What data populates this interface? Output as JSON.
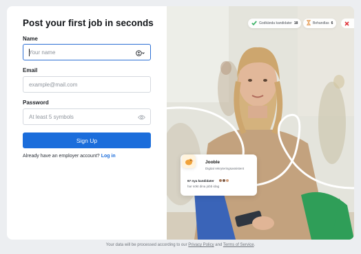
{
  "form": {
    "title": "Post your first job in seconds",
    "name": {
      "label": "Name",
      "placeholder": "Your name",
      "icon": "user-check-icon"
    },
    "email": {
      "label": "Email",
      "placeholder": "example@mail.com"
    },
    "password": {
      "label": "Password",
      "placeholder": "At least 5 symbols",
      "icon": "eye-icon"
    },
    "submit_label": "Sign Up",
    "login_prompt": "Already have an employer account?",
    "login_link": "Log in"
  },
  "hero": {
    "stats": [
      {
        "label": "Godkända kandidater",
        "value": "18",
        "icon": "check-icon",
        "color": "#3fb36a"
      },
      {
        "label": "Behandlas",
        "value": "6",
        "icon": "hourglass-icon",
        "color": "#e2964b"
      }
    ],
    "reject_icon": "close-icon",
    "reject_color": "#e0383e",
    "card": {
      "name": "Jooble",
      "role": "Digital rekryteringsassistent",
      "count": "67 nya kandidater",
      "subtitle": "har sökt dina jobb idag"
    }
  },
  "footer": {
    "prefix": "Your data will be processed according to our",
    "privacy_link": "Privacy Policy",
    "and": "and",
    "terms_link": "Terms of Service",
    "suffix": "."
  },
  "colors": {
    "accent": "#1b6ddb",
    "background": "#eceef1",
    "sweater_green": "#2f9e58",
    "sweater_blue": "#3a64b8"
  }
}
